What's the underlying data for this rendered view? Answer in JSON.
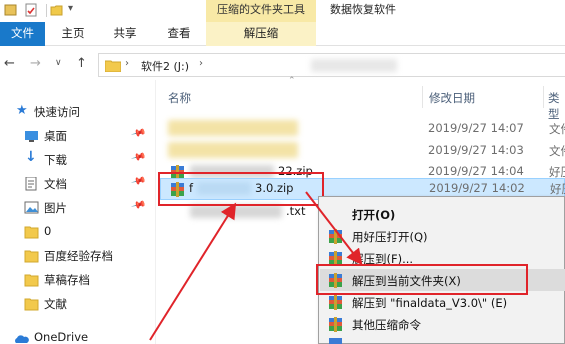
{
  "titlebar": {
    "context_tab_title": "压缩的文件夹工具",
    "window_title": "数据恢复软件"
  },
  "ribbon": {
    "tabs": [
      "文件",
      "主页",
      "共享",
      "查看",
      "解压缩"
    ]
  },
  "address": {
    "segment_1": "软件2 (J:)"
  },
  "columns": {
    "name": "名称",
    "date": "修改日期",
    "type": "类型"
  },
  "nav": {
    "items": [
      "快速访问",
      "桌面",
      "下载",
      "文档",
      "图片",
      "0",
      "百度经验存档",
      "草稿存档",
      "文献",
      "OneDrive"
    ]
  },
  "files": [
    {
      "name_suffix": "",
      "date": "2019/9/27 14:07",
      "type": "文件"
    },
    {
      "name_suffix": "",
      "date": "2019/9/27 14:03",
      "type": "文件"
    },
    {
      "name_suffix": "22.zip",
      "date": "2019/9/27 14:04",
      "type": "好压"
    },
    {
      "name_prefix": "f",
      "name_suffix": "3.0.zip",
      "date": "2019/9/27 14:02",
      "type": "好压"
    },
    {
      "name_suffix": ".txt",
      "date": "",
      "type": ""
    }
  ],
  "context_menu": {
    "items": [
      "打开(O)",
      "用好压打开(Q)",
      "解压到(F)...",
      "解压到当前文件夹(X)",
      "解压到 \"finaldata_V3.0\\\" (E)",
      "其他压缩命令"
    ]
  },
  "colors": {
    "accent": "#1979ca",
    "context_tab": "#f8e9a6",
    "selection": "#cce8ff",
    "annotation": "#e0242a"
  }
}
